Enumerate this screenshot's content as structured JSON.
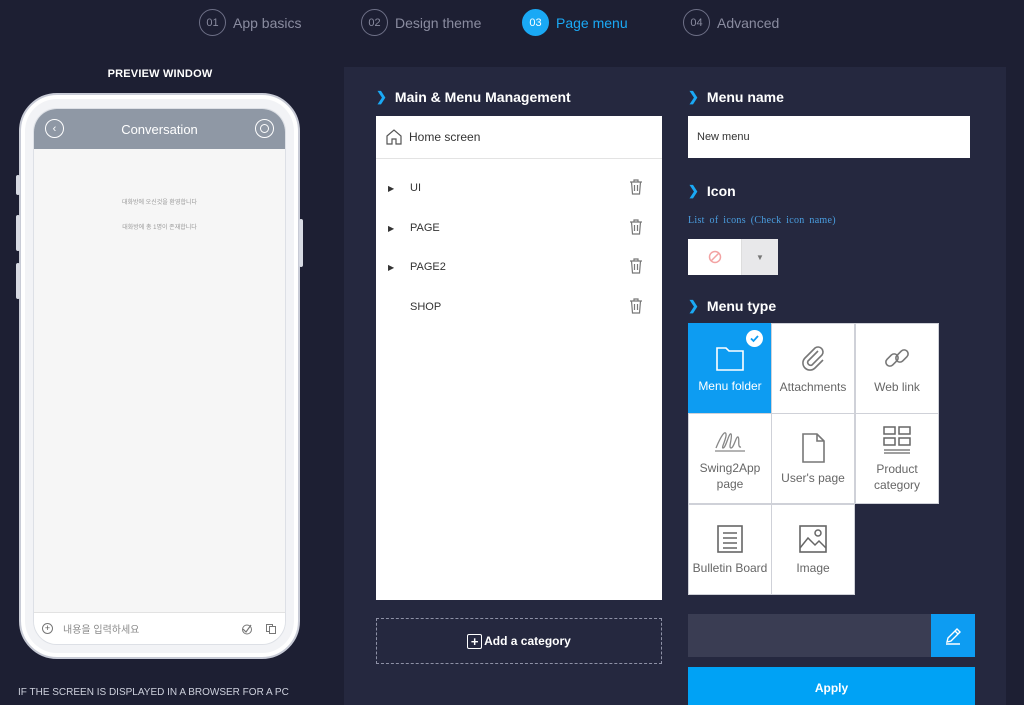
{
  "steps": [
    {
      "num": "01",
      "label": "App basics"
    },
    {
      "num": "02",
      "label": "Design theme"
    },
    {
      "num": "03",
      "label": "Page menu"
    },
    {
      "num": "04",
      "label": "Advanced"
    }
  ],
  "active_step": "03",
  "preview": {
    "title": "PREVIEW WINDOW",
    "screen_title": "Conversation",
    "chat_lines": [
      "대화방에 오신것을 환영합니다",
      "대화방에 총 1명이 존재합니다"
    ],
    "input_placeholder": "내용을 입력하세요",
    "note": "IF THE SCREEN IS DISPLAYED IN A BROWSER FOR A PC"
  },
  "main": {
    "title": "Main & Menu Management",
    "home_label": "Home screen",
    "items": [
      {
        "label": "UI",
        "expandable": true
      },
      {
        "label": "PAGE",
        "expandable": true
      },
      {
        "label": "PAGE2",
        "expandable": true
      },
      {
        "label": "SHOP",
        "expandable": false
      }
    ],
    "add_category": "Add a category"
  },
  "menu_name": {
    "title": "Menu name",
    "value": "New menu"
  },
  "icon": {
    "title": "Icon",
    "hint": "List of icons (Check icon name)"
  },
  "menu_type": {
    "title": "Menu type",
    "options": [
      {
        "label": "Menu folder",
        "icon": "folder-icon",
        "selected": true
      },
      {
        "label": "Attachments",
        "icon": "paperclip-icon",
        "selected": false
      },
      {
        "label": "Web link",
        "icon": "link-icon",
        "selected": false
      },
      {
        "label": "Swing2App page",
        "icon": "signature-icon",
        "selected": false
      },
      {
        "label": "User's page",
        "icon": "file-icon",
        "selected": false
      },
      {
        "label": "Product category",
        "icon": "grid-icon",
        "selected": false
      },
      {
        "label": "Bulletin Board",
        "icon": "list-icon",
        "selected": false
      },
      {
        "label": "Image",
        "icon": "image-icon",
        "selected": false
      }
    ]
  },
  "apply_label": "Apply",
  "colors": {
    "accent": "#0d9cf2",
    "background": "#1d1f33",
    "panel": "#25283f"
  }
}
